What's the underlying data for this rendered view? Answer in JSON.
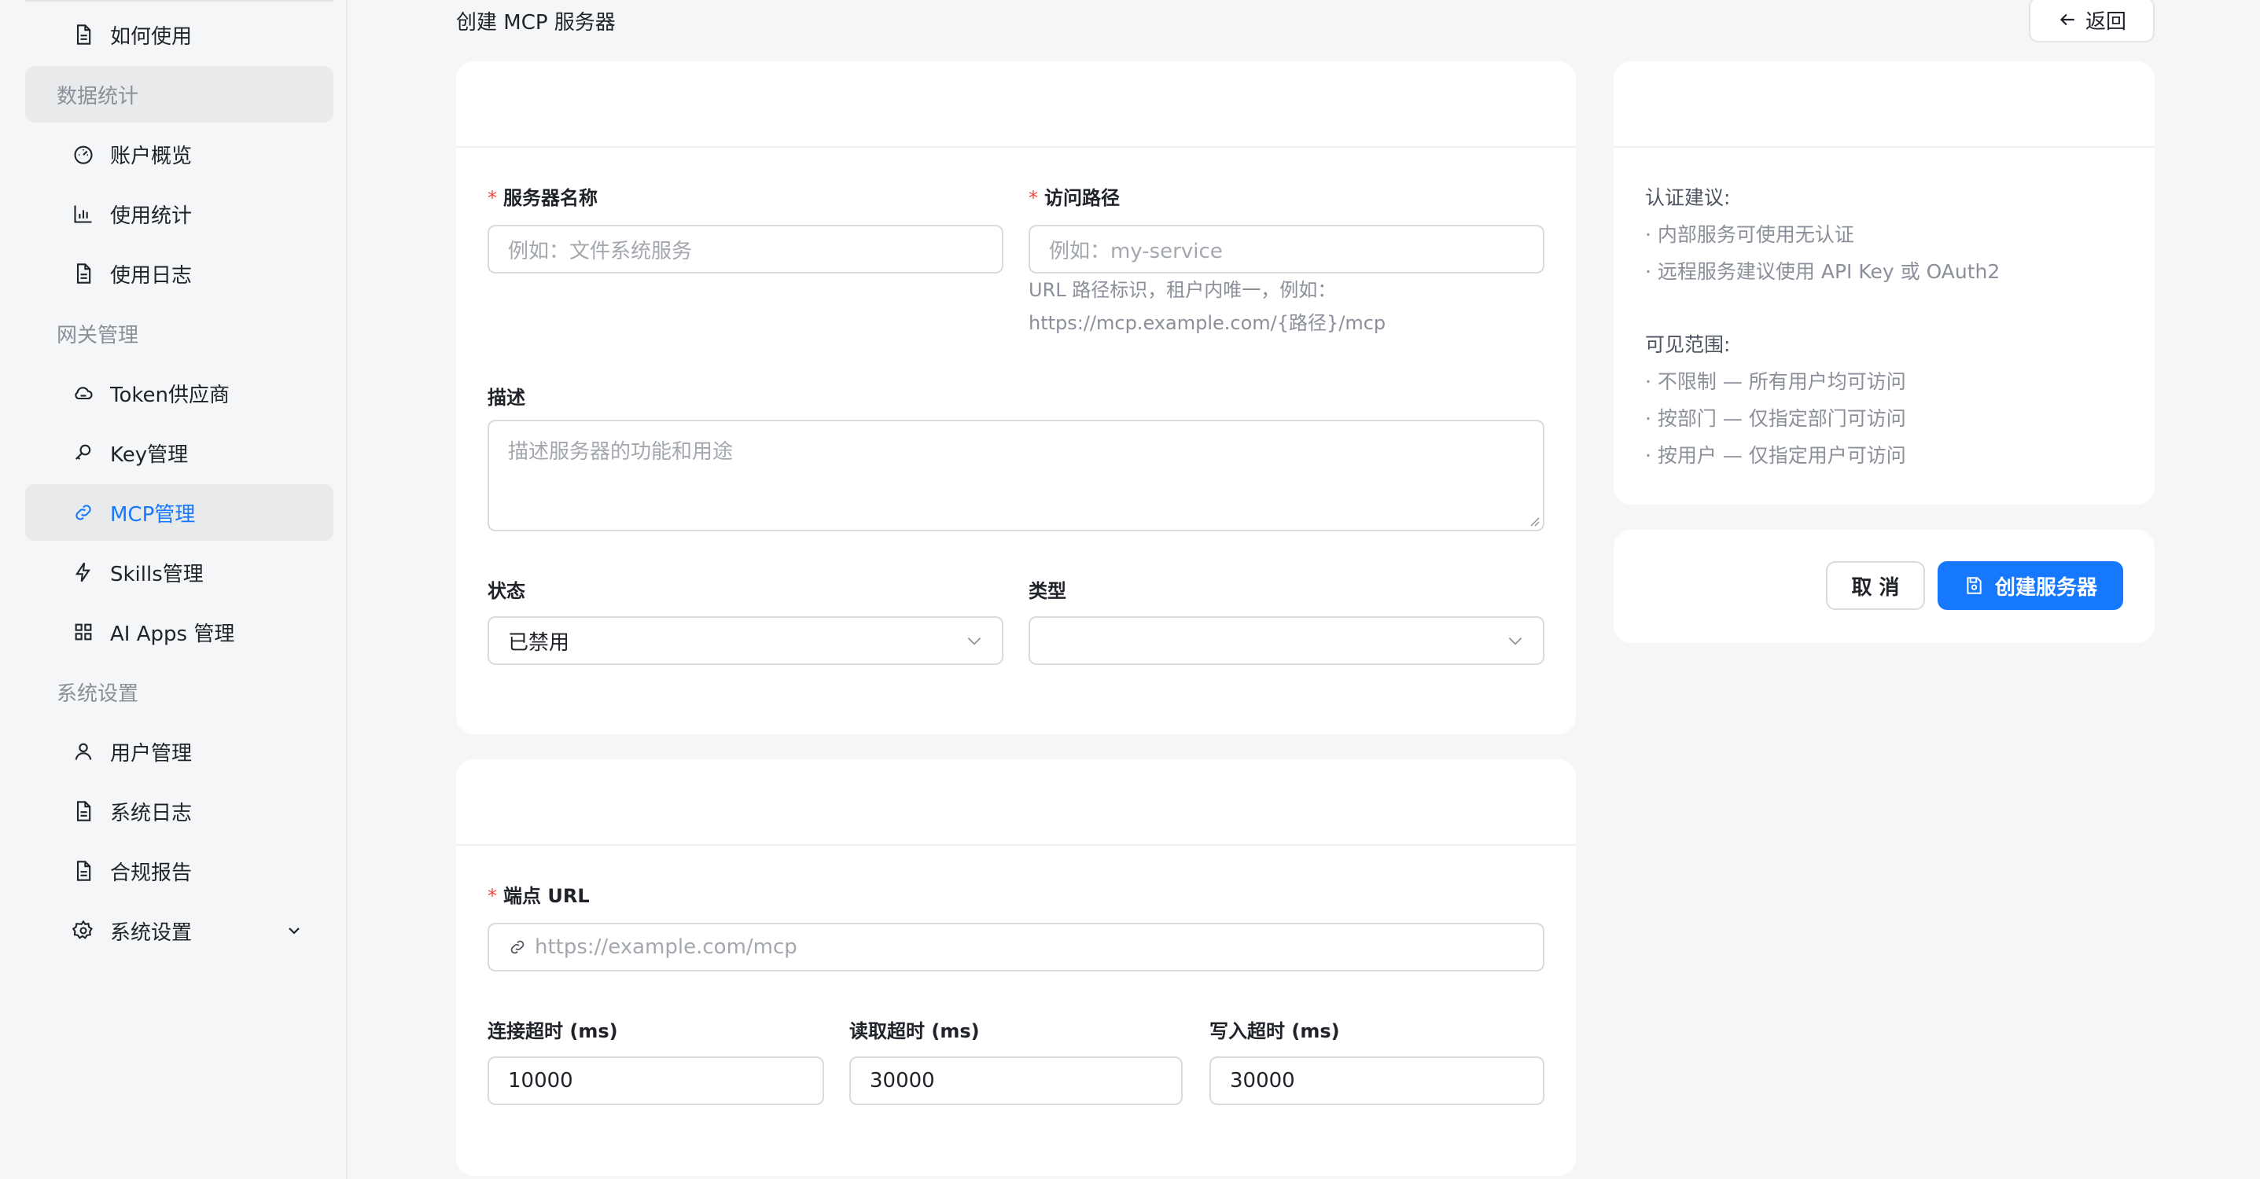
{
  "sidebar": {
    "items": [
      {
        "label": "如何使用",
        "icon": "file-icon"
      },
      {
        "group": "数据统计"
      },
      {
        "label": "账户概览",
        "icon": "dashboard-icon"
      },
      {
        "label": "使用统计",
        "icon": "bar-chart-icon"
      },
      {
        "label": "使用日志",
        "icon": "file-icon"
      },
      {
        "group": "网关管理"
      },
      {
        "label": "Token供应商",
        "icon": "cloud-icon"
      },
      {
        "label": "Key管理",
        "icon": "key-icon"
      },
      {
        "label": "MCP管理",
        "icon": "link-icon",
        "active": true
      },
      {
        "label": "Skills管理",
        "icon": "bolt-icon"
      },
      {
        "label": "AI Apps 管理",
        "icon": "apps-grid-icon"
      },
      {
        "group": "系统设置"
      },
      {
        "label": "用户管理",
        "icon": "user-icon"
      },
      {
        "label": "系统日志",
        "icon": "file-icon"
      },
      {
        "label": "合规报告",
        "icon": "file-icon"
      },
      {
        "label": "系统设置",
        "icon": "gear-icon",
        "expandable": true
      }
    ]
  },
  "header": {
    "title": "创建 MCP 服务器",
    "back_label": "返回"
  },
  "basic": {
    "name_label": "服务器名称",
    "name_placeholder": "例如：文件系统服务",
    "path_label": "访问路径",
    "path_placeholder": "例如：my-service",
    "path_help_1": "URL 路径标识，租户内唯一，例如：",
    "path_help_2": "https://mcp.example.com/{路径}/mcp",
    "desc_label": "描述",
    "desc_placeholder": "描述服务器的功能和用途",
    "status_label": "状态",
    "status_value": "已禁用",
    "type_label": "类型",
    "type_value": ""
  },
  "connection": {
    "endpoint_label": "端点 URL",
    "endpoint_placeholder": "https://example.com/mcp",
    "connect_timeout_label": "连接超时 (ms)",
    "connect_timeout_value": "10000",
    "read_timeout_label": "读取超时 (ms)",
    "read_timeout_value": "30000",
    "write_timeout_label": "写入超时 (ms)",
    "write_timeout_value": "30000"
  },
  "tips": {
    "auth_title": "认证建议:",
    "auth_items": [
      "内部服务可使用无认证",
      "远程服务建议使用 API Key 或 OAuth2"
    ],
    "scope_title": "可见范围:",
    "scope_items": [
      "不限制 — 所有用户均可访问",
      "按部门 — 仅指定部门可访问",
      "按用户 — 仅指定用户可访问"
    ]
  },
  "actions": {
    "cancel_label": "取 消",
    "create_label": "创建服务器"
  },
  "colors": {
    "primary": "#1677ff",
    "required": "#f5483b",
    "active_bg": "#e9eaec"
  }
}
